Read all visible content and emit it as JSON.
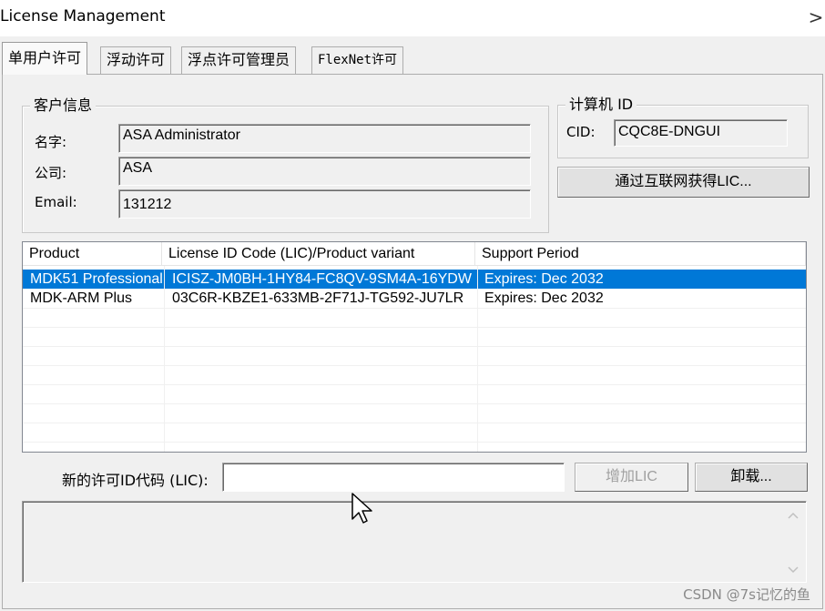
{
  "window": {
    "title": "License Management",
    "close_glyph": ">"
  },
  "tabs": [
    {
      "label": "单用户许可",
      "active": true
    },
    {
      "label": "浮动许可",
      "active": false
    },
    {
      "label": "浮点许可管理员",
      "active": false
    },
    {
      "label": "FlexNet许可",
      "active": false
    }
  ],
  "customer_info": {
    "title": "客户信息",
    "name_label": "名字:",
    "name_value": "ASA Administrator",
    "company_label": "公司:",
    "company_value": "ASA",
    "email_label": "Email:",
    "email_value": "131212"
  },
  "computer_id": {
    "title": "计算机 ID",
    "cid_label": "CID:",
    "cid_value": "CQC8E-DNGUI",
    "get_lic_button": "通过互联网获得LIC..."
  },
  "license_table": {
    "columns": [
      "Product",
      "License ID Code (LIC)/Product variant",
      "Support Period"
    ],
    "rows": [
      {
        "product": "MDK51 Professional",
        "lic": "ICISZ-JM0BH-1HY84-FC8QV-9SM4A-16YDW",
        "support": "Expires: Dec 2032",
        "selected": true
      },
      {
        "product": "MDK-ARM Plus",
        "lic": "03C6R-KBZE1-633MB-2F71J-TG592-JU7LR",
        "support": "Expires: Dec 2032",
        "selected": false
      }
    ],
    "selection_color": "#0078d7"
  },
  "new_lic": {
    "label": "新的许可ID代码 (LIC):",
    "value": "",
    "add_button": "增加LIC",
    "uninstall_button": "卸载..."
  },
  "output": {
    "scroll_up_icon": "chevron-up-icon",
    "scroll_down_icon": "chevron-down-icon"
  },
  "watermark": "CSDN @7s记忆的鱼"
}
